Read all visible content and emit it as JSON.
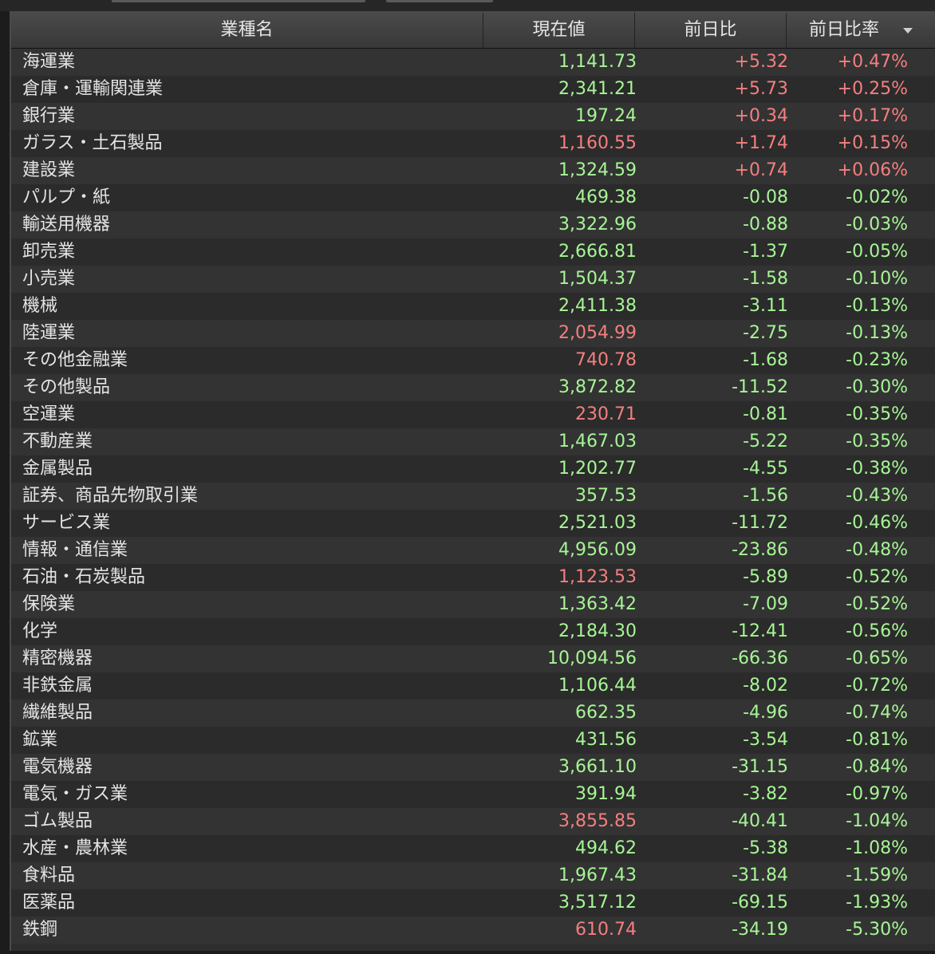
{
  "columns": [
    "業種名",
    "現在値",
    "前日比",
    "前日比率"
  ],
  "colors": {
    "up": "#f47f7f",
    "down": "#a6f595",
    "neutral": "#e4e4e4"
  },
  "rows": [
    {
      "name": "海運業",
      "price": "1,141.73",
      "pc": "g",
      "chg": "+5.32",
      "pct": "+0.47%",
      "cc": "r"
    },
    {
      "name": "倉庫・運輸関連業",
      "price": "2,341.21",
      "pc": "g",
      "chg": "+5.73",
      "pct": "+0.25%",
      "cc": "r"
    },
    {
      "name": "銀行業",
      "price": "197.24",
      "pc": "g",
      "chg": "+0.34",
      "pct": "+0.17%",
      "cc": "r"
    },
    {
      "name": "ガラス・土石製品",
      "price": "1,160.55",
      "pc": "r",
      "chg": "+1.74",
      "pct": "+0.15%",
      "cc": "r"
    },
    {
      "name": "建設業",
      "price": "1,324.59",
      "pc": "g",
      "chg": "+0.74",
      "pct": "+0.06%",
      "cc": "r"
    },
    {
      "name": "パルプ・紙",
      "price": "469.38",
      "pc": "g",
      "chg": "-0.08",
      "pct": "-0.02%",
      "cc": "g"
    },
    {
      "name": "輸送用機器",
      "price": "3,322.96",
      "pc": "g",
      "chg": "-0.88",
      "pct": "-0.03%",
      "cc": "g"
    },
    {
      "name": "卸売業",
      "price": "2,666.81",
      "pc": "g",
      "chg": "-1.37",
      "pct": "-0.05%",
      "cc": "g"
    },
    {
      "name": "小売業",
      "price": "1,504.37",
      "pc": "g",
      "chg": "-1.58",
      "pct": "-0.10%",
      "cc": "g"
    },
    {
      "name": "機械",
      "price": "2,411.38",
      "pc": "g",
      "chg": "-3.11",
      "pct": "-0.13%",
      "cc": "g"
    },
    {
      "name": "陸運業",
      "price": "2,054.99",
      "pc": "r",
      "chg": "-2.75",
      "pct": "-0.13%",
      "cc": "g"
    },
    {
      "name": "その他金融業",
      "price": "740.78",
      "pc": "r",
      "chg": "-1.68",
      "pct": "-0.23%",
      "cc": "g"
    },
    {
      "name": "その他製品",
      "price": "3,872.82",
      "pc": "g",
      "chg": "-11.52",
      "pct": "-0.30%",
      "cc": "g"
    },
    {
      "name": "空運業",
      "price": "230.71",
      "pc": "r",
      "chg": "-0.81",
      "pct": "-0.35%",
      "cc": "g"
    },
    {
      "name": "不動産業",
      "price": "1,467.03",
      "pc": "g",
      "chg": "-5.22",
      "pct": "-0.35%",
      "cc": "g"
    },
    {
      "name": "金属製品",
      "price": "1,202.77",
      "pc": "g",
      "chg": "-4.55",
      "pct": "-0.38%",
      "cc": "g"
    },
    {
      "name": "証券、商品先物取引業",
      "price": "357.53",
      "pc": "g",
      "chg": "-1.56",
      "pct": "-0.43%",
      "cc": "g"
    },
    {
      "name": "サービス業",
      "price": "2,521.03",
      "pc": "g",
      "chg": "-11.72",
      "pct": "-0.46%",
      "cc": "g"
    },
    {
      "name": "情報・通信業",
      "price": "4,956.09",
      "pc": "g",
      "chg": "-23.86",
      "pct": "-0.48%",
      "cc": "g"
    },
    {
      "name": "石油・石炭製品",
      "price": "1,123.53",
      "pc": "r",
      "chg": "-5.89",
      "pct": "-0.52%",
      "cc": "g"
    },
    {
      "name": "保険業",
      "price": "1,363.42",
      "pc": "g",
      "chg": "-7.09",
      "pct": "-0.52%",
      "cc": "g"
    },
    {
      "name": "化学",
      "price": "2,184.30",
      "pc": "g",
      "chg": "-12.41",
      "pct": "-0.56%",
      "cc": "g"
    },
    {
      "name": "精密機器",
      "price": "10,094.56",
      "pc": "g",
      "chg": "-66.36",
      "pct": "-0.65%",
      "cc": "g"
    },
    {
      "name": "非鉄金属",
      "price": "1,106.44",
      "pc": "g",
      "chg": "-8.02",
      "pct": "-0.72%",
      "cc": "g"
    },
    {
      "name": "繊維製品",
      "price": "662.35",
      "pc": "g",
      "chg": "-4.96",
      "pct": "-0.74%",
      "cc": "g"
    },
    {
      "name": "鉱業",
      "price": "431.56",
      "pc": "g",
      "chg": "-3.54",
      "pct": "-0.81%",
      "cc": "g"
    },
    {
      "name": "電気機器",
      "price": "3,661.10",
      "pc": "g",
      "chg": "-31.15",
      "pct": "-0.84%",
      "cc": "g"
    },
    {
      "name": "電気・ガス業",
      "price": "391.94",
      "pc": "g",
      "chg": "-3.82",
      "pct": "-0.97%",
      "cc": "g"
    },
    {
      "name": "ゴム製品",
      "price": "3,855.85",
      "pc": "r",
      "chg": "-40.41",
      "pct": "-1.04%",
      "cc": "g"
    },
    {
      "name": "水産・農林業",
      "price": "494.62",
      "pc": "g",
      "chg": "-5.38",
      "pct": "-1.08%",
      "cc": "g"
    },
    {
      "name": "食料品",
      "price": "1,967.43",
      "pc": "g",
      "chg": "-31.84",
      "pct": "-1.59%",
      "cc": "g"
    },
    {
      "name": "医薬品",
      "price": "3,517.12",
      "pc": "g",
      "chg": "-69.15",
      "pct": "-1.93%",
      "cc": "g"
    },
    {
      "name": "鉄鋼",
      "price": "610.74",
      "pc": "r",
      "chg": "-34.19",
      "pct": "-5.30%",
      "cc": "g"
    }
  ]
}
